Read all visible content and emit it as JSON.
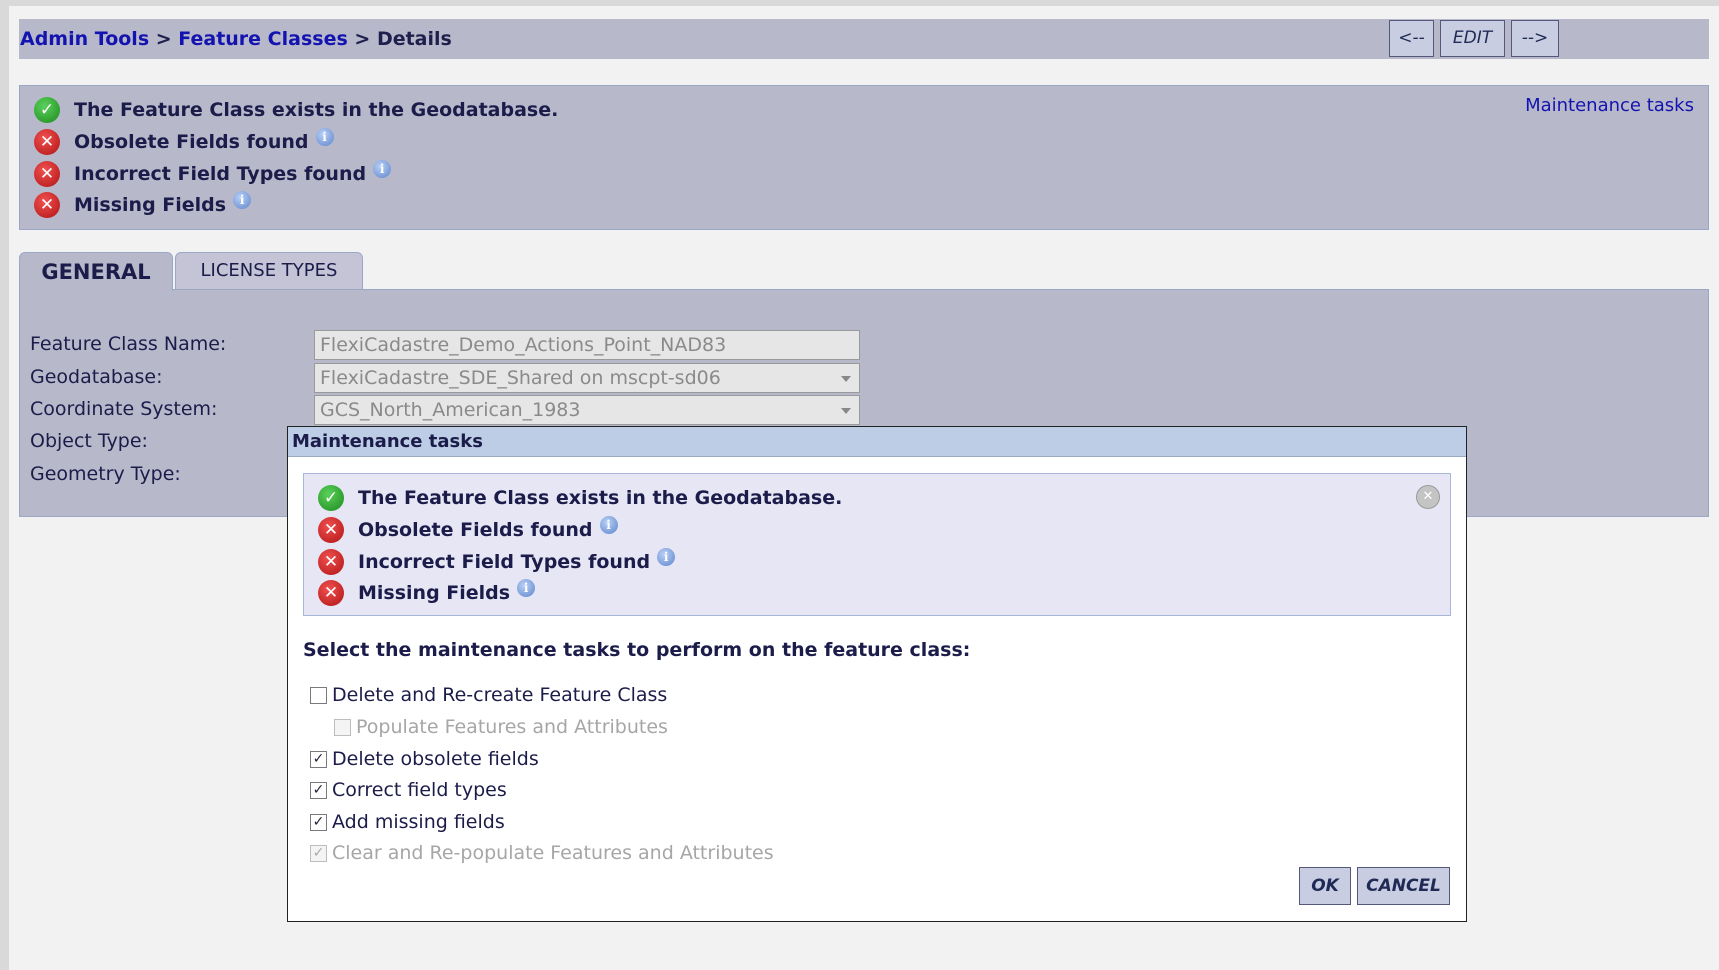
{
  "breadcrumb": {
    "item1": "Admin Tools",
    "sep1": " > ",
    "item2": "Feature Classes",
    "sep2": " > ",
    "current": "Details"
  },
  "nav": {
    "prev_label": "<--",
    "edit_label": "EDIT",
    "next_label": "-->"
  },
  "status": {
    "maintenance_link": "Maintenance tasks",
    "items": [
      {
        "text": "The Feature Class exists in the Geodatabase.",
        "state": "ok",
        "info": false
      },
      {
        "text": "Obsolete Fields found",
        "state": "error",
        "info": true
      },
      {
        "text": "Incorrect Field Types found",
        "state": "error",
        "info": true
      },
      {
        "text": "Missing Fields",
        "state": "error",
        "info": true
      }
    ]
  },
  "tabs": {
    "general": "GENERAL",
    "license_types": "LICENSE TYPES"
  },
  "form": {
    "feature_class_name_label": "Feature Class Name:",
    "feature_class_name_value": "FlexiCadastre_Demo_Actions_Point_NAD83",
    "geodatabase_label": "Geodatabase:",
    "geodatabase_value": "FlexiCadastre_SDE_Shared on mscpt-sd06",
    "coordinate_system_label": "Coordinate System:",
    "coordinate_system_value": "GCS_North_American_1983",
    "object_type_label": "Object Type:",
    "geometry_type_label": "Geometry Type:"
  },
  "modal": {
    "title": "Maintenance tasks",
    "prompt": "Select the maintenance tasks to perform on the feature class:",
    "tasks": [
      {
        "label": "Delete and Re-create Feature Class",
        "checked": false,
        "disabled": false
      },
      {
        "label": "Populate Features and Attributes",
        "checked": false,
        "disabled": true
      },
      {
        "label": "Delete obsolete fields",
        "checked": true,
        "disabled": false
      },
      {
        "label": "Correct field types",
        "checked": true,
        "disabled": false
      },
      {
        "label": "Add missing fields",
        "checked": true,
        "disabled": false
      },
      {
        "label": "Clear and Re-populate Features and Attributes",
        "checked": true,
        "disabled": true
      }
    ],
    "ok_label": "OK",
    "cancel_label": "CANCEL"
  },
  "icons": {
    "ok": "check-circle-icon",
    "error": "error-circle-icon",
    "info": "info-icon",
    "close": "close-circle-icon"
  },
  "colors": {
    "panel_bg": "#b8b8cb",
    "link": "#1313b0",
    "ok": "#1c8a1c",
    "error": "#b01212",
    "modal_title_bg": "#bccde5"
  }
}
